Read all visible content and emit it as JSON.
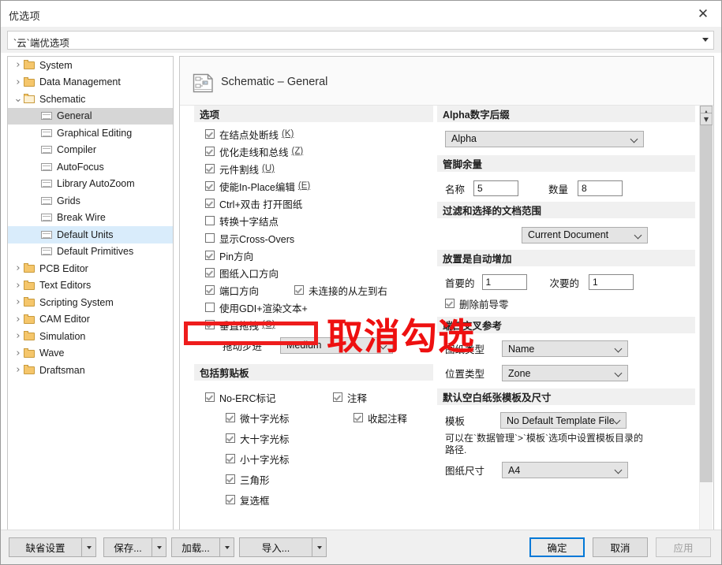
{
  "window": {
    "title": "优选项",
    "close_icon": "close-icon"
  },
  "top_combo": {
    "value": "`云`端优选项",
    "arrow_icon": "chevron-down-icon"
  },
  "tree": {
    "items": [
      {
        "label": "System",
        "level": 0,
        "type": "folder",
        "chevron": "collapsed",
        "state": "normal"
      },
      {
        "label": "Data Management",
        "level": 0,
        "type": "folder",
        "chevron": "collapsed",
        "state": "normal"
      },
      {
        "label": "Schematic",
        "level": 0,
        "type": "folderopen",
        "chevron": "expanded",
        "state": "normal"
      },
      {
        "label": "General",
        "level": 1,
        "type": "page",
        "chevron": "none",
        "state": "selected"
      },
      {
        "label": "Graphical Editing",
        "level": 1,
        "type": "page",
        "chevron": "none",
        "state": "normal"
      },
      {
        "label": "Compiler",
        "level": 1,
        "type": "page",
        "chevron": "none",
        "state": "normal"
      },
      {
        "label": "AutoFocus",
        "level": 1,
        "type": "page",
        "chevron": "none",
        "state": "normal"
      },
      {
        "label": "Library AutoZoom",
        "level": 1,
        "type": "page",
        "chevron": "none",
        "state": "normal"
      },
      {
        "label": "Grids",
        "level": 1,
        "type": "page",
        "chevron": "none",
        "state": "normal"
      },
      {
        "label": "Break Wire",
        "level": 1,
        "type": "page",
        "chevron": "none",
        "state": "normal"
      },
      {
        "label": "Default Units",
        "level": 1,
        "type": "page",
        "chevron": "none",
        "state": "hover"
      },
      {
        "label": "Default Primitives",
        "level": 1,
        "type": "page",
        "chevron": "none",
        "state": "normal"
      },
      {
        "label": "PCB Editor",
        "level": 0,
        "type": "folder",
        "chevron": "collapsed",
        "state": "normal"
      },
      {
        "label": "Text Editors",
        "level": 0,
        "type": "folder",
        "chevron": "collapsed",
        "state": "normal"
      },
      {
        "label": "Scripting System",
        "level": 0,
        "type": "folder",
        "chevron": "collapsed",
        "state": "normal"
      },
      {
        "label": "CAM Editor",
        "level": 0,
        "type": "folder",
        "chevron": "collapsed",
        "state": "normal"
      },
      {
        "label": "Simulation",
        "level": 0,
        "type": "folder",
        "chevron": "collapsed",
        "state": "normal"
      },
      {
        "label": "Wave",
        "level": 0,
        "type": "folder",
        "chevron": "collapsed",
        "state": "normal"
      },
      {
        "label": "Draftsman",
        "level": 0,
        "type": "folder",
        "chevron": "collapsed",
        "state": "normal"
      }
    ]
  },
  "panel": {
    "header_title": "Schematic – General",
    "header_icon": "schematic-document-icon",
    "left": {
      "options_section": {
        "title": "选项",
        "checkboxes": [
          {
            "label": "在结点处断线",
            "hotkey": "(K)",
            "checked": true
          },
          {
            "label": "优化走线和总线",
            "hotkey": "(Z)",
            "checked": true
          },
          {
            "label": "元件割线",
            "hotkey": "(U)",
            "checked": true
          },
          {
            "label": "使能In-Place编辑",
            "hotkey": "(E)",
            "checked": true
          },
          {
            "label": "Ctrl+双击 打开图纸",
            "hotkey": "",
            "checked": true
          },
          {
            "label": "转换十字结点",
            "hotkey": "",
            "checked": false
          },
          {
            "label": "显示Cross-Overs",
            "hotkey": "",
            "checked": false
          },
          {
            "label": "Pin方向",
            "hotkey": "",
            "checked": true
          },
          {
            "label": "图纸入口方向",
            "hotkey": "",
            "checked": true
          }
        ],
        "port_row": {
          "label": "端口方向",
          "checked": true
        },
        "unconnected_row": {
          "label": "未连接的从左到右",
          "checked": true
        },
        "gdi_row": {
          "label": "使用GDI+渲染文本+",
          "checked": false
        },
        "vertical_drag": {
          "label": "垂直拖拽",
          "hotkey": "(G)",
          "checked": true
        },
        "drag_step": {
          "label": "拖动步进",
          "value": "Medium",
          "arrow_icon": "chevron-down-icon"
        }
      },
      "clipboard_section": {
        "title": "包括剪贴板",
        "left_items": [
          {
            "label": "No-ERC标记",
            "checked": true,
            "indent": 0
          },
          {
            "label": "微十字光标",
            "checked": true,
            "indent": 1
          },
          {
            "label": "大十字光标",
            "checked": true,
            "indent": 1
          },
          {
            "label": "小十字光标",
            "checked": true,
            "indent": 1
          },
          {
            "label": "三角形",
            "checked": true,
            "indent": 1
          },
          {
            "label": "复选框",
            "checked": true,
            "indent": 1
          }
        ],
        "right_items": [
          {
            "label": "注释",
            "checked": true,
            "indent": 0
          },
          {
            "label": "收起注释",
            "checked": true,
            "indent": 1
          }
        ]
      }
    },
    "right": {
      "alpha_section": {
        "title": "Alpha数字后缀",
        "value": "Alpha",
        "arrow_icon": "chevron-down-icon"
      },
      "pin_margin_section": {
        "title": "管脚余量",
        "name_label": "名称",
        "name_value": "5",
        "qty_label": "数量",
        "qty_value": "8"
      },
      "filter_scope_section": {
        "title": "过滤和选择的文档范围",
        "value": "Current Document",
        "arrow_icon": "chevron-down-icon"
      },
      "auto_increment_section": {
        "title": "放置是自动增加",
        "primary_label": "首要的",
        "primary_value": "1",
        "secondary_label": "次要的",
        "secondary_value": "1",
        "remove_leading_zeros": {
          "label": "删除前导零",
          "checked": true
        }
      },
      "port_cross_ref_section": {
        "title": "端口交叉参考",
        "sheet_type_label": "图纸类型",
        "sheet_type_value": "Name",
        "location_type_label": "位置类型",
        "location_type_value": "Zone",
        "arrow_icon": "chevron-down-icon"
      },
      "default_template_section": {
        "title": "默认空白纸张模板及尺寸",
        "template_label": "模板",
        "template_value": "No Default Template File",
        "note": "可以在`数据管理`>`模板`选项中设置模板目录的路径.",
        "sheet_size_label": "图纸尺寸",
        "sheet_size_value": "A4",
        "arrow_icon": "chevron-down-icon"
      }
    },
    "scrollbar": {
      "up_icon": "chevron-up-icon",
      "down_icon": "chevron-down-icon"
    }
  },
  "footer": {
    "default_settings": "缺省设置",
    "save": "保存...",
    "load": "加载...",
    "import": "导入...",
    "ok": "确定",
    "cancel": "取消",
    "apply": "应用"
  },
  "annotation": {
    "text": "取消勾选",
    "color": "#ee1010",
    "box_color": "#ee1c1c"
  }
}
